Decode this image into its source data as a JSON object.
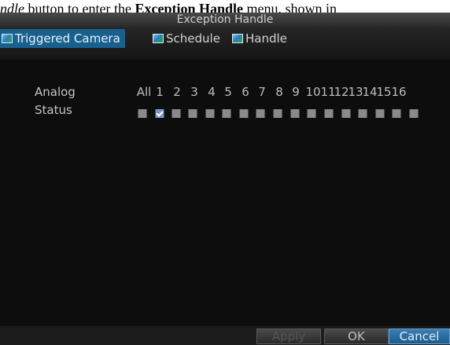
{
  "caption": {
    "part1": "ndle",
    "part2": " button to enter the ",
    "part3": "Exception Handle",
    "part4": " menu, shown in"
  },
  "window": {
    "title": "Exception Handle"
  },
  "tabs": [
    {
      "label": "Triggered Camera",
      "icon": "camera-tab-icon",
      "active": true
    },
    {
      "label": "Schedule",
      "icon": "schedule-tab-icon",
      "active": false
    },
    {
      "label": "Handle",
      "icon": "handle-tab-icon",
      "active": false
    }
  ],
  "grid": {
    "row_label": "Analog",
    "status_label": "Status",
    "all_label": "All",
    "channels": [
      {
        "num": "1",
        "checked": true
      },
      {
        "num": "2",
        "checked": false
      },
      {
        "num": "3",
        "checked": false
      },
      {
        "num": "4",
        "checked": false
      },
      {
        "num": "5",
        "checked": false
      },
      {
        "num": "6",
        "checked": false
      },
      {
        "num": "7",
        "checked": false
      },
      {
        "num": "8",
        "checked": false
      },
      {
        "num": "9",
        "checked": false
      },
      {
        "num": "10",
        "checked": false
      },
      {
        "num": "11",
        "checked": false
      },
      {
        "num": "12",
        "checked": false
      },
      {
        "num": "13",
        "checked": false
      },
      {
        "num": "14",
        "checked": false
      },
      {
        "num": "15",
        "checked": false
      },
      {
        "num": "16",
        "checked": false
      }
    ],
    "all_checked": false
  },
  "buttons": {
    "apply": "Apply",
    "ok": "OK",
    "cancel": "Cancel"
  },
  "colors": {
    "accent": "#18608e",
    "checked": "#7f97c8",
    "unchecked": "#8a8a8a"
  }
}
